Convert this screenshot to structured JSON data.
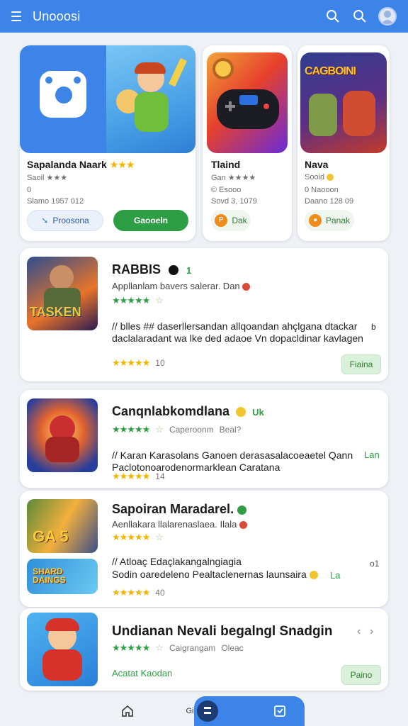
{
  "appbar": {
    "title": "Unooosi",
    "icons": [
      "menu-icon",
      "search-icon",
      "search-icon",
      "avatar"
    ]
  },
  "featured": [
    {
      "name": "Sapalanda Naark",
      "rating_stars": "★★★",
      "line1": "Saoil ★★★",
      "line2": "0",
      "line3": "Slamo 1957 012",
      "secondary_label": "Proosona",
      "primary_label": "Gaooeln"
    },
    {
      "name": "Tlaind",
      "line1": "Gan ★★★★",
      "line2": "© Esooo",
      "line3": "Sovd 3, 1079",
      "action_label": "Dak",
      "action_icon": "P"
    },
    {
      "name": "Nava",
      "line1": "Sooid",
      "line2": "0 Naooon",
      "line3": "Daano 128 09",
      "action_label": "Panak",
      "art_title": "CAGBOINI"
    }
  ],
  "list": [
    {
      "title": "RABBIS",
      "title_suffix": "1",
      "subtitle": "Appllanlam bavers salerar. Dan",
      "rating": "★★★★★",
      "description": "// blles ## daserllersandan allqoandan ahçlgana dtackar daclalaradant wa lke ded adaoe Vn dopacldinar kavlagen",
      "desc_suffix": "b",
      "rating2": "★★★★★",
      "count": "10",
      "button_label": "Fiaina",
      "thumb_text": "TASKEN"
    },
    {
      "title": "Canqnlabkomdlana",
      "title_suffix": "Uk",
      "rating": "★★★★★",
      "meta1": "Caperoonm",
      "meta2": "Beal?",
      "description": "// Karan Karasolans Ganoen derasasalacoeaetel Qann Paclotonoarodenormarklean Caratana",
      "desc_suffix": "Lan",
      "rating2": "★★★★★",
      "count": "14"
    },
    {
      "title": "Sapoiran Maradarel.",
      "subtitle": "Aenllakara llalarenaslaea. Ilala",
      "rating": "★★★★★",
      "description": "// Atloaç Edaçlakangalngiagia",
      "description2": "Sodin oaredeleno Pealtaclenernas launsaira",
      "desc_suffix": "o1",
      "desc_suffix2": "La",
      "rating2": "★★★★★",
      "count": "40",
      "thumb_text": "GA 5",
      "thumb2_text": "SHARD DAINGS"
    },
    {
      "title": "Undianan Nevali begalngl Snadgin",
      "rating": "★★★★★",
      "meta1": "Caigrangam",
      "meta2": "Oleac",
      "footer_label": "Acatat Kaodan",
      "button_label": "Paino"
    }
  ],
  "bottomnav": {
    "items": [
      "home-icon",
      "compass-icon",
      "bookmark-icon"
    ],
    "mid_label": "Gi"
  },
  "colors": {
    "primary": "#3d84e8",
    "green": "#2e9e45",
    "star": "#f4b400"
  }
}
